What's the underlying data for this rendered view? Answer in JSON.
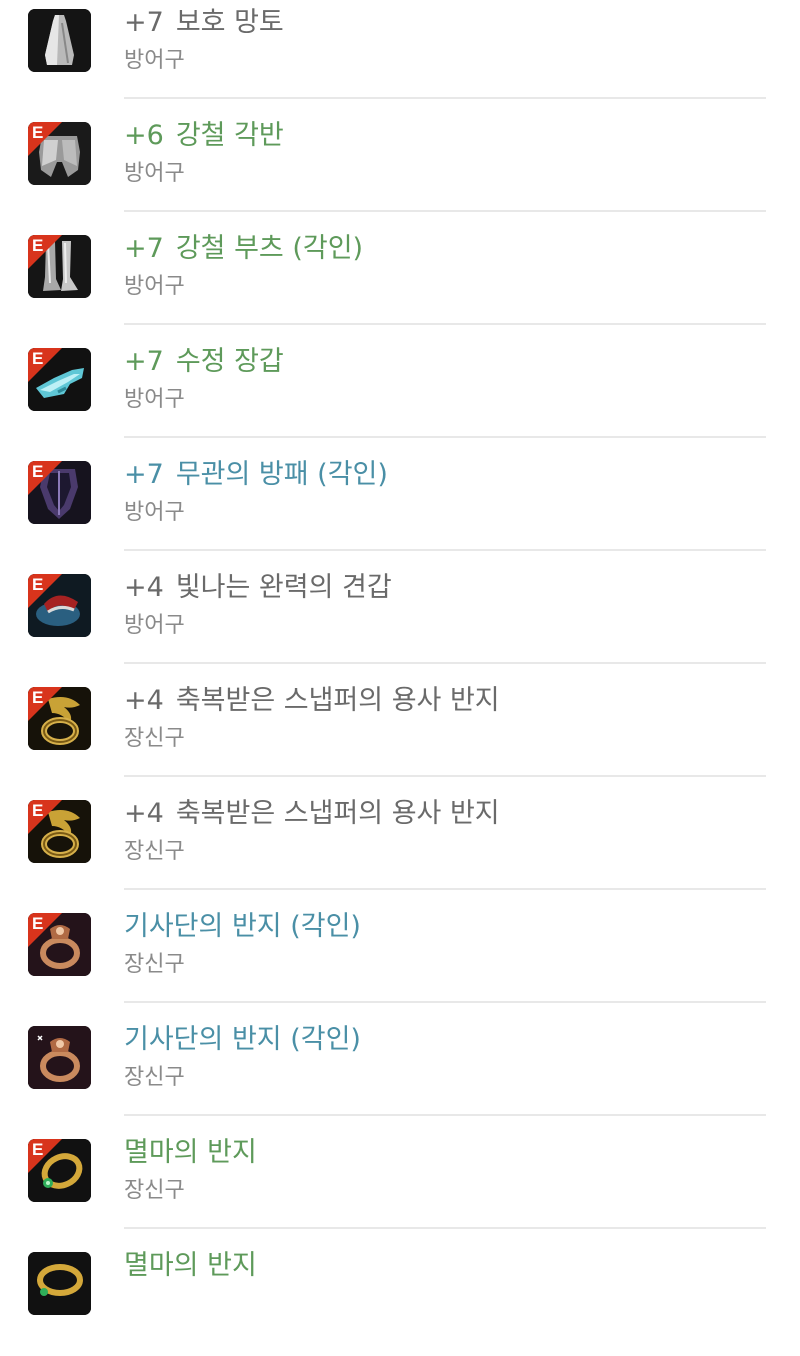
{
  "colors": {
    "normal": "#6a6a6a",
    "green": "#5e9a5a",
    "blue": "#4a8fa6",
    "category": "#8a8a8a",
    "enchant_badge": "#d8341c"
  },
  "items": [
    {
      "level": "+7",
      "name": "보호 망토",
      "category": "방어구",
      "color": "gray",
      "enchant": "",
      "icon": "cloak-icon"
    },
    {
      "level": "+6",
      "name": "강철 각반",
      "category": "방어구",
      "color": "green",
      "enchant": "E",
      "icon": "leggings-icon"
    },
    {
      "level": "+7",
      "name": "강철 부츠 (각인)",
      "category": "방어구",
      "color": "green",
      "enchant": "E",
      "icon": "boots-icon"
    },
    {
      "level": "+7",
      "name": "수정 장갑",
      "category": "방어구",
      "color": "green",
      "enchant": "E",
      "icon": "gloves-icon"
    },
    {
      "level": "+7",
      "name": "무관의 방패 (각인)",
      "category": "방어구",
      "color": "blue",
      "enchant": "E",
      "icon": "shield-icon"
    },
    {
      "level": "+4",
      "name": "빛나는 완력의 견갑",
      "category": "방어구",
      "color": "gray",
      "enchant": "E",
      "icon": "pauldron-icon"
    },
    {
      "level": "+4",
      "name": "축복받은 스냅퍼의 용사 반지",
      "category": "장신구",
      "color": "gray",
      "enchant": "E",
      "icon": "gold-ring-icon"
    },
    {
      "level": "+4",
      "name": "축복받은 스냅퍼의 용사 반지",
      "category": "장신구",
      "color": "gray",
      "enchant": "E",
      "icon": "gold-ring-icon"
    },
    {
      "level": "",
      "name": "기사단의 반지 (각인)",
      "category": "장신구",
      "color": "blue",
      "enchant": "E",
      "icon": "copper-ring-icon"
    },
    {
      "level": "",
      "name": "기사단의 반지 (각인)",
      "category": "장신구",
      "color": "blue",
      "enchant": "",
      "icon": "copper-ring-icon"
    },
    {
      "level": "",
      "name": "멸마의 반지",
      "category": "장신구",
      "color": "green",
      "enchant": "E",
      "icon": "emerald-ring-icon"
    },
    {
      "level": "",
      "name": "멸마의 반지",
      "category": "",
      "color": "green",
      "enchant": "",
      "icon": "emerald-ring-icon"
    }
  ]
}
